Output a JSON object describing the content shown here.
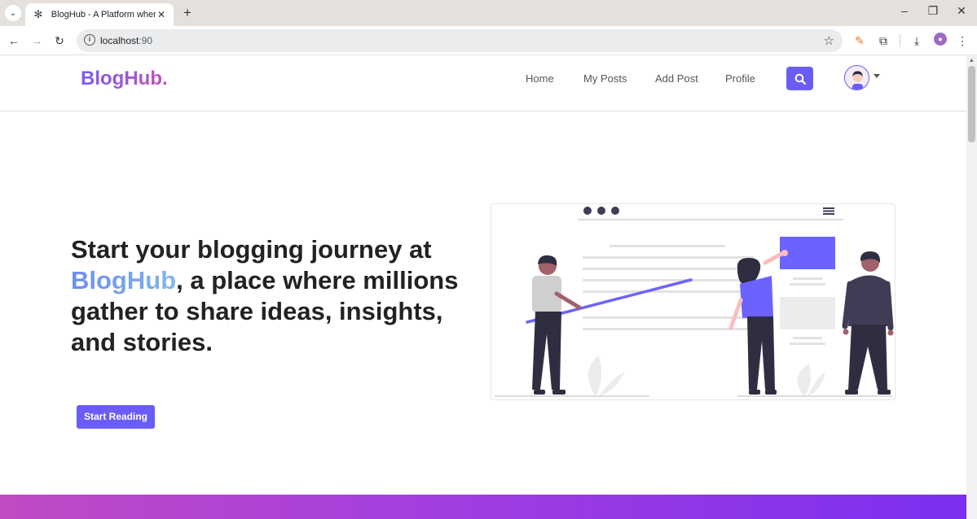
{
  "browser": {
    "tab_title": "BlogHub - A Platform where yo",
    "url_host": "localhost",
    "url_port": ":90"
  },
  "site": {
    "brand": "BlogHub.",
    "nav": {
      "home": "Home",
      "my_posts": "My Posts",
      "add_post": "Add Post",
      "profile": "Profile"
    },
    "hero": {
      "line_pre": "Start your blogging journey at ",
      "highlight": "BlogHub",
      "line_post": ", a place where millions gather to share ideas, insights, and stories.",
      "cta": "Start Reading"
    }
  },
  "colors": {
    "accent": "#6a5df5",
    "footer_gradient_start": "#c04bc3",
    "footer_gradient_end": "#7b2ff0"
  },
  "icons": {
    "search": "search-icon",
    "avatar": "user-avatar",
    "star": "bookmark-star-icon"
  }
}
